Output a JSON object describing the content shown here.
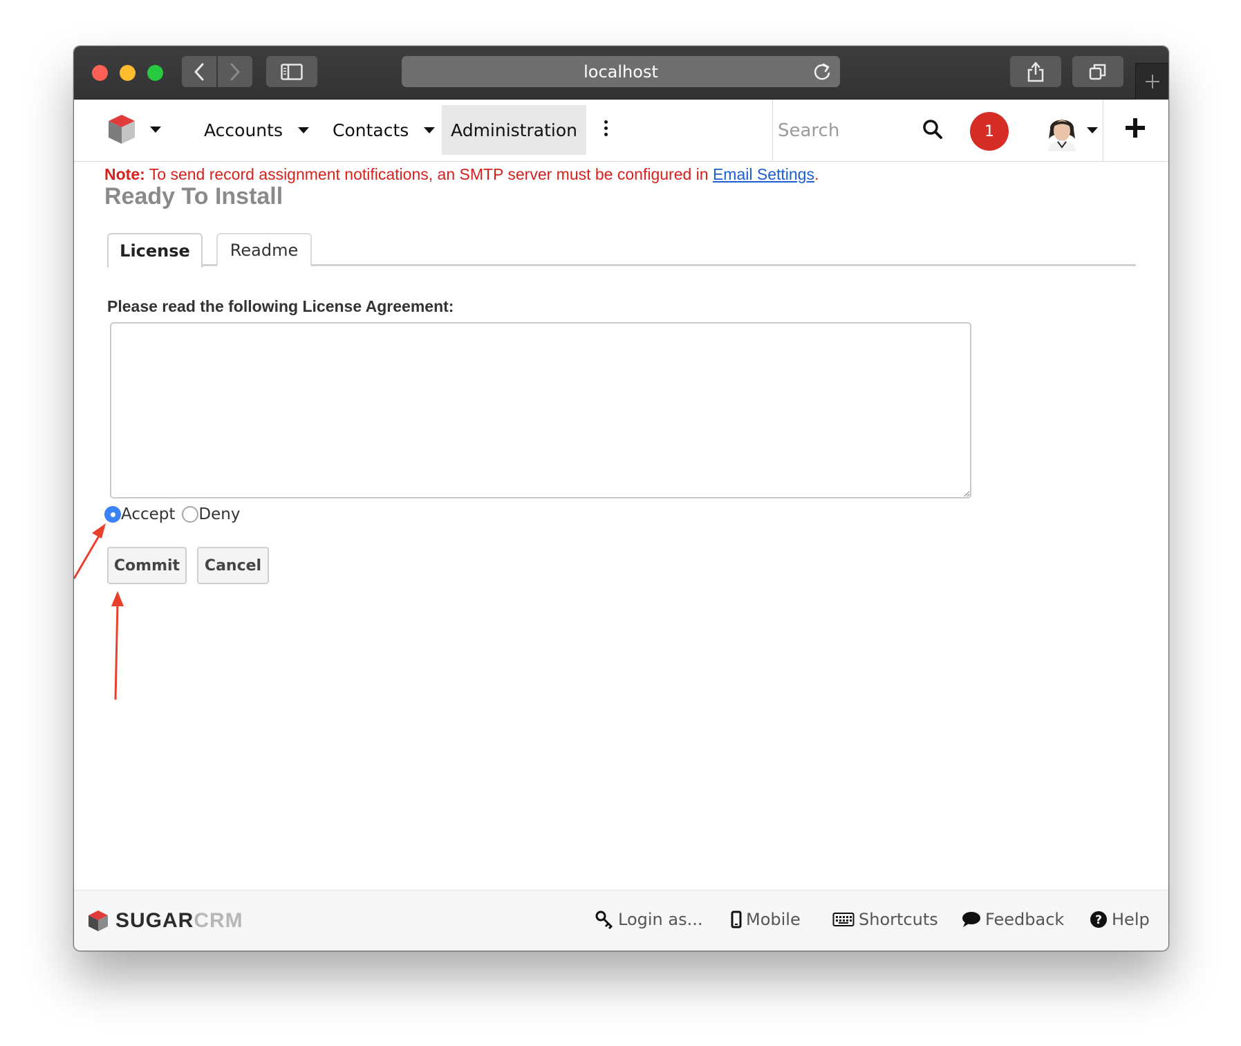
{
  "browser": {
    "url": "localhost"
  },
  "nav": {
    "items": [
      {
        "label": "Accounts"
      },
      {
        "label": "Contacts"
      },
      {
        "label": "Administration"
      }
    ],
    "search_placeholder": "Search",
    "notification_count": "1"
  },
  "content": {
    "note_prefix": "Note:",
    "note_text": " To send record assignment notifications, an SMTP server must be configured in ",
    "note_link": "Email Settings",
    "note_suffix": ".",
    "page_title": "Ready To Install",
    "tabs": [
      {
        "label": "License",
        "active": true
      },
      {
        "label": "Readme",
        "active": false
      }
    ],
    "prompt": "Please read the following License Agreement:",
    "license_text": "",
    "radio_accept": "Accept",
    "radio_deny": "Deny",
    "selected": "Accept",
    "commit_label": "Commit",
    "cancel_label": "Cancel"
  },
  "footer": {
    "brand_part1": "SUGAR",
    "brand_part2": "CRM",
    "links": [
      {
        "label": "Login as...",
        "icon": "key-icon"
      },
      {
        "label": "Mobile",
        "icon": "mobile-icon"
      },
      {
        "label": "Shortcuts",
        "icon": "keyboard-icon"
      },
      {
        "label": "Feedback",
        "icon": "speech-bubble-icon"
      },
      {
        "label": "Help",
        "icon": "question-circle-icon"
      }
    ]
  },
  "colors": {
    "note_red": "#d7211d",
    "link_blue": "#1a5fd1",
    "notification_red": "#d62e26",
    "annotation_arrow": "#e8402c",
    "radio_checked": "#3b82f6"
  }
}
